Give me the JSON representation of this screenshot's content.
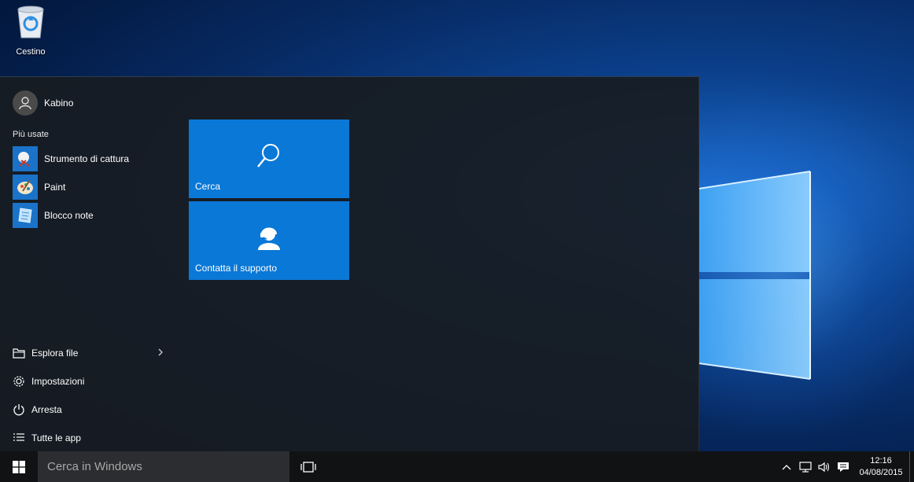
{
  "desktop": {
    "recycle_bin_label": "Cestino"
  },
  "start_menu": {
    "user_name": "Kabino",
    "most_used_heading": "Più usate",
    "most_used": [
      {
        "label": "Strumento di cattura",
        "icon": "snipping-tool-icon"
      },
      {
        "label": "Paint",
        "icon": "paint-icon"
      },
      {
        "label": "Blocco note",
        "icon": "notepad-icon"
      }
    ],
    "bottom_items": [
      {
        "label": "Esplora file",
        "icon": "folder-icon"
      },
      {
        "label": "Impostazioni",
        "icon": "gear-icon"
      },
      {
        "label": "Arresta",
        "icon": "power-icon"
      },
      {
        "label": "Tutte le app",
        "icon": "list-icon"
      }
    ],
    "tiles": [
      {
        "label": "Cerca",
        "icon": "search-icon"
      },
      {
        "label": "Contatta il supporto",
        "icon": "support-agent-icon"
      }
    ]
  },
  "taskbar": {
    "search_placeholder": "Cerca in Windows",
    "time": "12:16",
    "date": "04/08/2015"
  },
  "colors": {
    "accent": "#0a78d7",
    "start_bg": "#181c21",
    "taskbar_bg": "#101214"
  }
}
